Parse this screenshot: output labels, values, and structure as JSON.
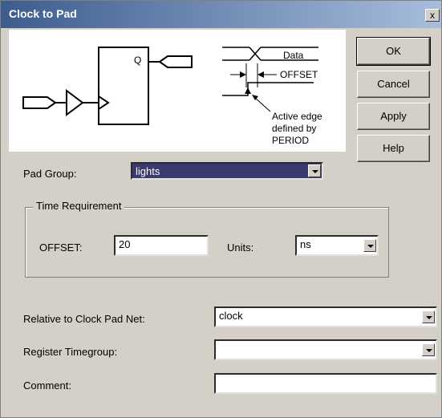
{
  "window": {
    "title": "Clock to Pad",
    "close_label": "x"
  },
  "diagram": {
    "q_label": "Q",
    "data_label": "Data",
    "offset_label": "OFFSET",
    "active_edge_lines": [
      "Active edge",
      "defined by",
      "PERIOD"
    ]
  },
  "buttons": {
    "ok": "OK",
    "cancel": "Cancel",
    "apply": "Apply",
    "help": "Help"
  },
  "pad_group": {
    "label": "Pad Group:",
    "value": "lights"
  },
  "time_requirement": {
    "legend": "Time Requirement",
    "offset_label": "OFFSET:",
    "offset_value": "20",
    "units_label": "Units:",
    "units_value": "ns"
  },
  "relative_clock": {
    "label": "Relative to Clock Pad Net:",
    "value": "clock"
  },
  "register_timegroup": {
    "label": "Register Timegroup:",
    "value": ""
  },
  "comment": {
    "label": "Comment:",
    "value": ""
  }
}
